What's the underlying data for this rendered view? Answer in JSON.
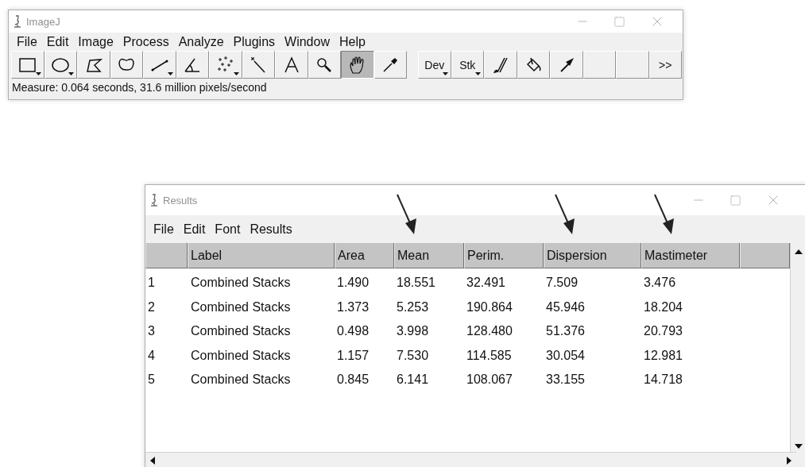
{
  "imagej_window": {
    "title": "ImageJ",
    "menu": [
      "File",
      "Edit",
      "Image",
      "Process",
      "Analyze",
      "Plugins",
      "Window",
      "Help"
    ],
    "tools": [
      {
        "kind": "rectangle",
        "selected": false,
        "has_menu": true
      },
      {
        "kind": "oval",
        "selected": false,
        "has_menu": true
      },
      {
        "kind": "polygon",
        "selected": false,
        "has_menu": false
      },
      {
        "kind": "freehand",
        "selected": false,
        "has_menu": false
      },
      {
        "kind": "line",
        "selected": false,
        "has_menu": true
      },
      {
        "kind": "angle",
        "selected": false,
        "has_menu": false
      },
      {
        "kind": "multipoint",
        "selected": false,
        "has_menu": true
      },
      {
        "kind": "wand",
        "selected": false,
        "has_menu": false
      },
      {
        "kind": "text",
        "selected": false,
        "has_menu": false
      },
      {
        "kind": "magnifier",
        "selected": false,
        "has_menu": false
      },
      {
        "kind": "hand",
        "selected": true,
        "has_menu": false
      },
      {
        "kind": "dropper",
        "selected": false,
        "has_menu": false
      },
      {
        "kind": "separator"
      },
      {
        "kind": "label",
        "label": "Dev",
        "selected": false,
        "has_menu": true
      },
      {
        "kind": "label",
        "label": "Stk",
        "selected": false,
        "has_menu": true
      },
      {
        "kind": "brush",
        "selected": false,
        "has_menu": false
      },
      {
        "kind": "bucket",
        "selected": false,
        "has_menu": false
      },
      {
        "kind": "arrow",
        "selected": false,
        "has_menu": false
      },
      {
        "kind": "empty",
        "selected": false,
        "has_menu": false
      },
      {
        "kind": "empty",
        "selected": false,
        "has_menu": false
      },
      {
        "kind": "label",
        "label": ">>",
        "selected": false,
        "has_menu": false
      }
    ],
    "status": "Measure: 0.064 seconds, 31.6 million pixels/second"
  },
  "results_window": {
    "title": "Results",
    "menu": [
      "File",
      "Edit",
      "Font",
      "Results"
    ],
    "table": {
      "columns": [
        "Label",
        "Area",
        "Mean",
        "Perim.",
        "Dispersion",
        "Mastimeter"
      ],
      "rows": [
        {
          "index": "1",
          "cells": [
            "Combined Stacks",
            "1.490",
            "18.551",
            "32.491",
            "7.509",
            "3.476"
          ]
        },
        {
          "index": "2",
          "cells": [
            "Combined Stacks",
            "1.373",
            "5.253",
            "190.864",
            "45.946",
            "18.204"
          ]
        },
        {
          "index": "3",
          "cells": [
            "Combined Stacks",
            "0.498",
            "3.998",
            "128.480",
            "51.376",
            "20.793"
          ]
        },
        {
          "index": "4",
          "cells": [
            "Combined Stacks",
            "1.157",
            "7.530",
            "114.585",
            "30.054",
            "12.981"
          ]
        },
        {
          "index": "5",
          "cells": [
            "Combined Stacks",
            "0.845",
            "6.141",
            "108.067",
            "33.155",
            "14.718"
          ]
        }
      ]
    }
  }
}
